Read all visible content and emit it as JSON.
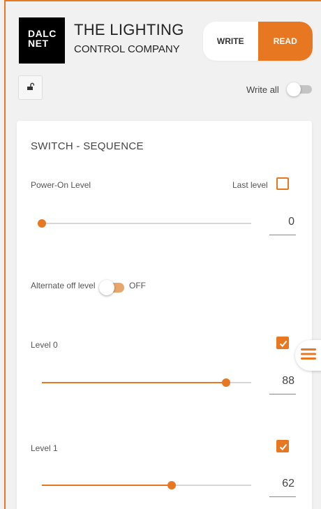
{
  "header": {
    "logo_line1": "DALC",
    "logo_line2": "NET",
    "company_line1": "THE LIGHTING",
    "company_line2": "CONTROL COMPANY",
    "write_label": "WRITE",
    "read_label": "READ",
    "mode_selected": "READ"
  },
  "toolbar": {
    "lock_icon": "lock-open-icon",
    "write_all_label": "Write all",
    "write_all_on": false
  },
  "card": {
    "title": "SWITCH - SEQUENCE",
    "power_on": {
      "label": "Power-On Level",
      "last_level_label": "Last level",
      "last_level_checked": false,
      "slider_fraction": 0.0,
      "value": "0"
    },
    "alternate_off": {
      "label": "Alternate off level",
      "state_label": "OFF"
    },
    "levels": [
      {
        "label": "Level 0",
        "checked": true,
        "value": "88",
        "slider_fraction": 0.88
      },
      {
        "label": "Level 1",
        "checked": true,
        "value": "62",
        "slider_fraction": 0.62
      }
    ]
  },
  "menu_fab_icon": "hamburger-menu-icon",
  "colors": {
    "accent": "#e87722",
    "accent_light": "#e8a76a",
    "rail": "#d6d6d6"
  }
}
